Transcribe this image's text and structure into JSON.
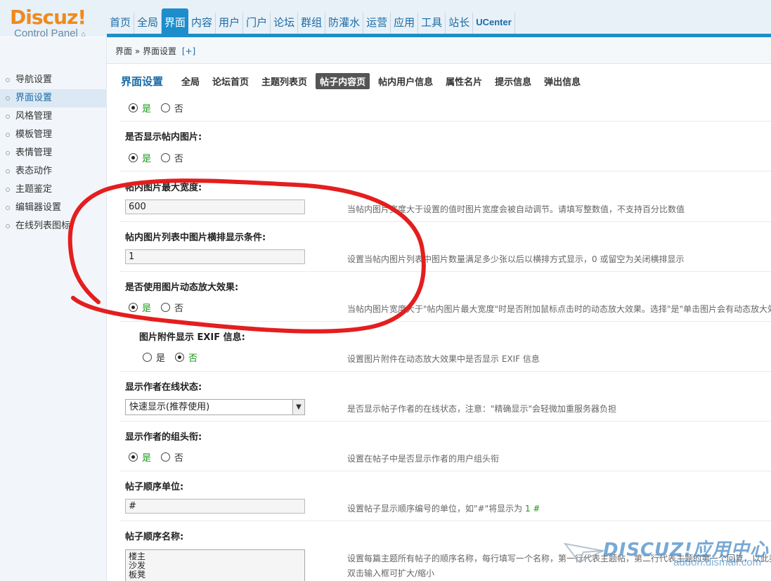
{
  "logo": {
    "brand": "Discuz!",
    "sub": "Control Panel"
  },
  "nav": [
    "首页",
    "全局",
    "界面",
    "内容",
    "用户",
    "门户",
    "论坛",
    "群组",
    "防灌水",
    "运营",
    "应用",
    "工具",
    "站长",
    "UCenter"
  ],
  "nav_active": "界面",
  "sidebar": {
    "items": [
      "导航设置",
      "界面设置",
      "风格管理",
      "模板管理",
      "表情管理",
      "表态动作",
      "主题鉴定",
      "编辑器设置",
      "在线列表图标"
    ],
    "active": "界面设置"
  },
  "breadcrumb": {
    "path": "界面 » 界面设置",
    "plus": "[+]"
  },
  "section": {
    "title": "界面设置",
    "tabs": [
      "全局",
      "论坛首页",
      "主题列表页",
      "帖子内容页",
      "帖内用户信息",
      "属性名片",
      "提示信息",
      "弹出信息"
    ],
    "active_tab": "帖子内容页"
  },
  "radio": {
    "yes": "是",
    "no": "否"
  },
  "form": {
    "row0": {
      "value": "是"
    },
    "row1": {
      "label": "是否显示帖内图片:",
      "value": "是"
    },
    "row2": {
      "label": "帖内图片最大宽度:",
      "value": "600",
      "tip": "当帖内图片宽度大于设置的值时图片宽度会被自动调节。请填写整数值，不支持百分比数值"
    },
    "row3": {
      "label": "帖内图片列表中图片横排显示条件:",
      "value": "1",
      "tip": "设置当帖内图片列表中图片数量满足多少张以后以横排方式显示，0 或留空为关闭横排显示"
    },
    "row4": {
      "label": "是否使用图片动态放大效果:",
      "value": "是",
      "tip": "当帖内图片宽度大于\"帖内图片最大宽度\"时是否附加鼠标点击时的动态放大效果。选择\"是\"单击图片会有动态放大效果"
    },
    "row5": {
      "label": "图片附件显示 EXIF 信息:",
      "value": "否",
      "tip": "设置图片附件在动态放大效果中是否显示 EXIF 信息"
    },
    "row6": {
      "label": "显示作者在线状态:",
      "value": "快速显示(推荐使用)",
      "tip": "是否显示帖子作者的在线状态，注意：\"精确显示\"会轻微加重服务器负担"
    },
    "row7": {
      "label": "显示作者的组头衔:",
      "value": "是",
      "tip": "设置在帖子中是否显示作者的用户组头衔"
    },
    "row8": {
      "label": "帖子顺序单位:",
      "value": "#",
      "tip": "设置帖子显示顺序编号的单位，如\"#\"将显示为",
      "tip_example": "1 #"
    },
    "row9": {
      "label": "帖子顺序名称:",
      "lines": [
        "楼主",
        "沙发",
        "板凳"
      ],
      "tip": "设置每篇主题所有帖子的顺序名称，每行填写一个名称，第一行代表主题帖，第二行代表主题的第一个回复，以此类推",
      "tip2": "双击输入框可扩大/缩小"
    }
  },
  "watermark": {
    "main": "DISCUZ!应用中心",
    "sub": "addon.dismall.com"
  },
  "colors": {
    "accent": "#1d8ecb",
    "logo": "#f08a1c",
    "selected_radio": "#1a9a1a",
    "annotation": "#e41e1e"
  }
}
